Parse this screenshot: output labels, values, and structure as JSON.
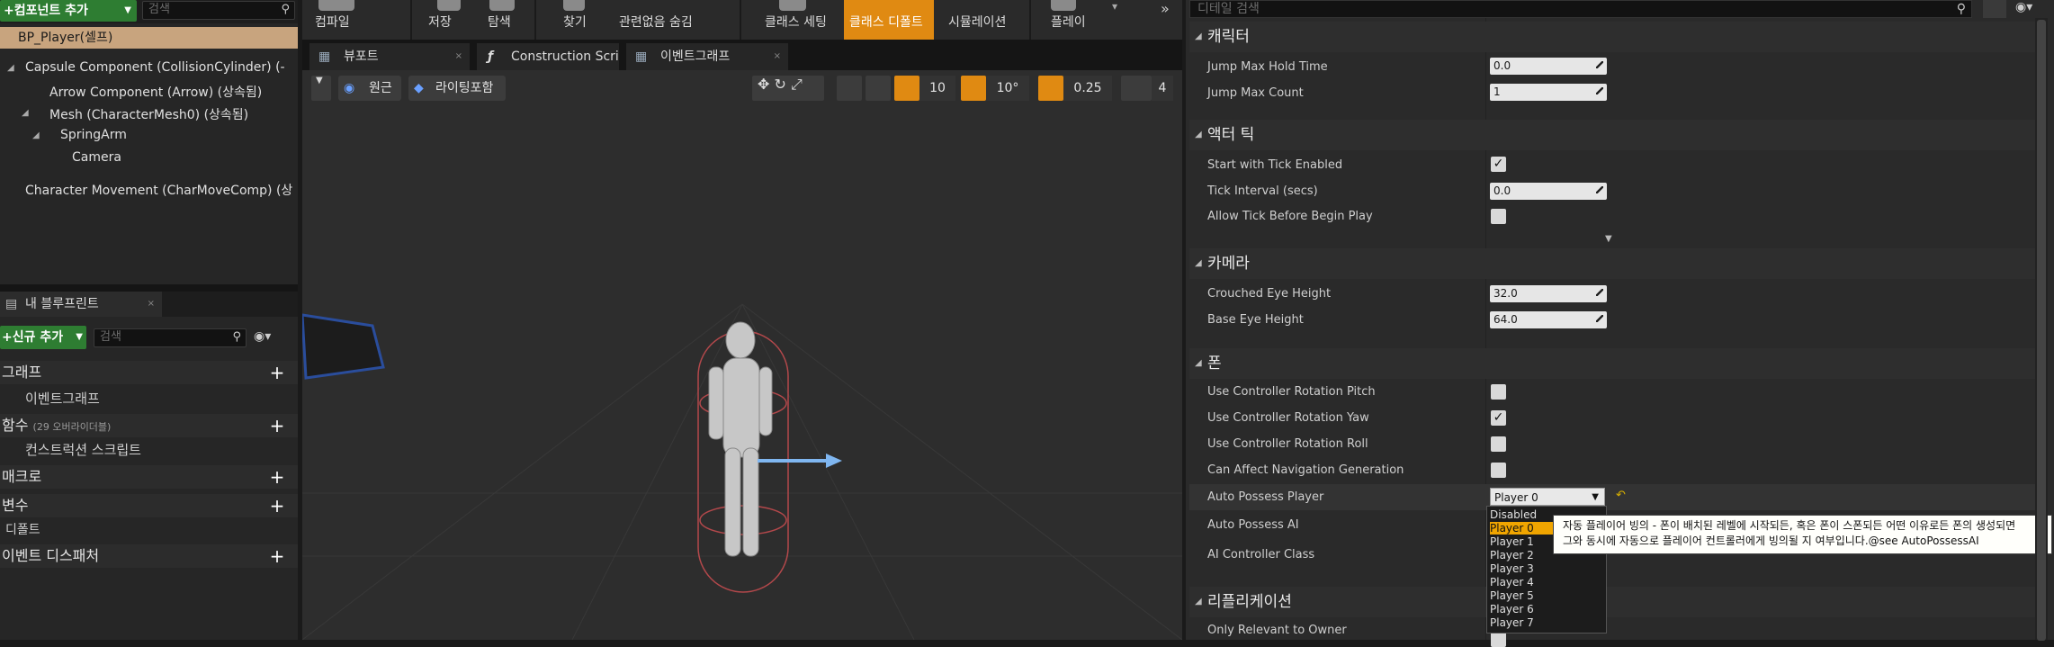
{
  "left_panel": {
    "add_component_label": "+컴포넌트 추가",
    "search_placeholder": "검색",
    "selected_item": "BP_Player(셀프)",
    "components": [
      {
        "label": "Capsule Component (CollisionCylinder) (-"
      },
      {
        "label": "Arrow Component (Arrow) (상속됨)"
      },
      {
        "label": "Mesh (CharacterMesh0) (상속됨)"
      },
      {
        "label": "SpringArm"
      },
      {
        "label": "Camera"
      },
      {
        "label": "Character Movement (CharMoveComp) (상"
      }
    ],
    "my_blueprint_tab": "내 블루프린트",
    "add_new_label": "+신규 추가",
    "search2_placeholder": "검색",
    "sections": {
      "graph": "그래프",
      "event_graph": "이벤트그래프",
      "functions": "함수",
      "functions_note": "(29 오버라이더블)",
      "construction_script": "컨스트럭션 스크립트",
      "macros": "매크로",
      "variables": "변수",
      "default": "디폴트",
      "event_dispatchers": "이벤트 디스패처"
    }
  },
  "toolbar": {
    "items": [
      "컴파일",
      "저장",
      "탐색",
      "찾기",
      "관련없음 숨김",
      "클래스 세팅",
      "클래스 디폴트",
      "시뮬레이션",
      "플레이"
    ]
  },
  "editor_tabs": [
    "뷰포트",
    "Construction Script",
    "이벤트그래프"
  ],
  "viewport": {
    "perspective_label": "원근",
    "lighting_label": "라이팅포함",
    "grid_snap": "10",
    "rotation_snap": "10°",
    "scale_snap": "0.25",
    "camera_speed": "4"
  },
  "details": {
    "search_placeholder": "디테일 검색",
    "sections": {
      "character": "캐릭터",
      "actor_tick": "액터 틱",
      "camera": "카메라",
      "pawn": "폰",
      "replication": "리플리케이션"
    },
    "rows": {
      "jump_max_hold_time": {
        "label": "Jump Max Hold Time",
        "value": "0.0"
      },
      "jump_max_count": {
        "label": "Jump Max Count",
        "value": "1"
      },
      "start_with_tick": {
        "label": "Start with Tick Enabled",
        "checked": true
      },
      "tick_interval": {
        "label": "Tick Interval (secs)",
        "value": "0.0"
      },
      "allow_tick_before": {
        "label": "Allow Tick Before Begin Play",
        "checked": false
      },
      "crouched_eye_height": {
        "label": "Crouched Eye Height",
        "value": "32.0"
      },
      "base_eye_height": {
        "label": "Base Eye Height",
        "value": "64.0"
      },
      "use_ctrl_pitch": {
        "label": "Use Controller Rotation Pitch",
        "checked": false
      },
      "use_ctrl_yaw": {
        "label": "Use Controller Rotation Yaw",
        "checked": true
      },
      "use_ctrl_roll": {
        "label": "Use Controller Rotation Roll",
        "checked": false
      },
      "can_affect_nav": {
        "label": "Can Affect Navigation Generation",
        "checked": false
      },
      "auto_possess_player": {
        "label": "Auto Possess Player",
        "value": "Player 0"
      },
      "auto_possess_ai": {
        "label": "Auto Possess AI"
      },
      "ai_controller_class": {
        "label": "AI Controller Class"
      },
      "only_relevant_owner": {
        "label": "Only Relevant to Owner"
      }
    },
    "dropdown_options": [
      "Disabled",
      "Player 0",
      "Player 1",
      "Player 2",
      "Player 3",
      "Player 4",
      "Player 5",
      "Player 6",
      "Player 7"
    ],
    "tooltip_line1": "자동 플레이어 빙의 - 폰이 배치된 레벨에 시작되든, 혹은 폰이 스폰되든 어떤 이유로든 폰의 생성되면",
    "tooltip_line2": "그와 동시에 자동으로 플레이어 컨트롤러에게 빙의될 지 여부입니다.@see AutoPossessAI"
  }
}
